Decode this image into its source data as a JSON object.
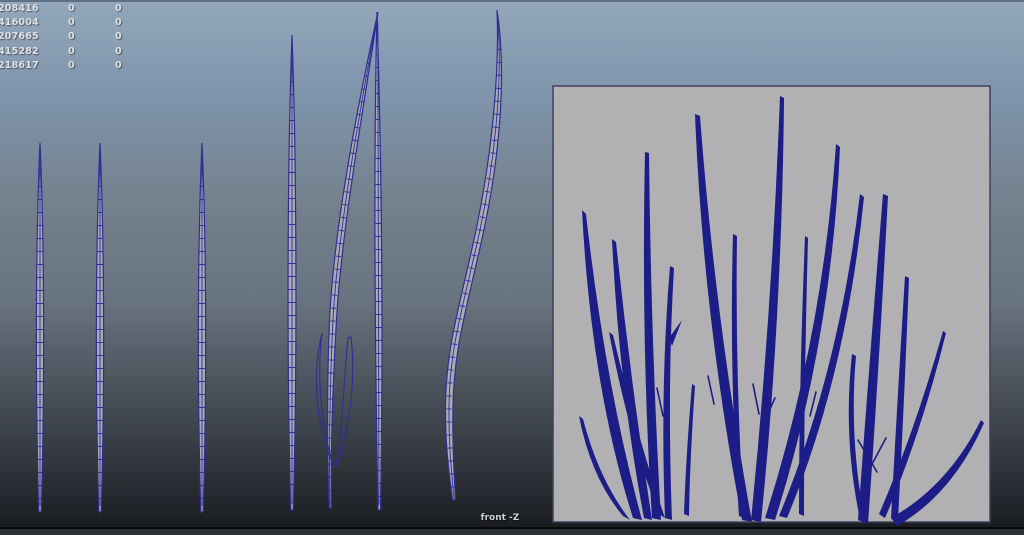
{
  "viewport": {
    "camera_label": "front -Z"
  },
  "hud": {
    "rows": [
      {
        "c1": "208416",
        "c2": "0",
        "c3": "0"
      },
      {
        "c1": "416004",
        "c2": "0",
        "c3": "0"
      },
      {
        "c1": "207665",
        "c2": "0",
        "c3": "0"
      },
      {
        "c1": "415282",
        "c2": "0",
        "c3": "0"
      },
      {
        "c1": "218617",
        "c2": "0",
        "c3": "0"
      }
    ]
  },
  "colors": {
    "hud_text": "#dfe1e4",
    "wire_navy": "#2e2e96",
    "wire_gray": "#a9abb0",
    "grass_navy": "#1d1d87",
    "panel_gray": "#b1b1b3",
    "panel_border": "#3f415c",
    "bg_top": "#93a7bc",
    "bg_bottom": "#17191d"
  }
}
